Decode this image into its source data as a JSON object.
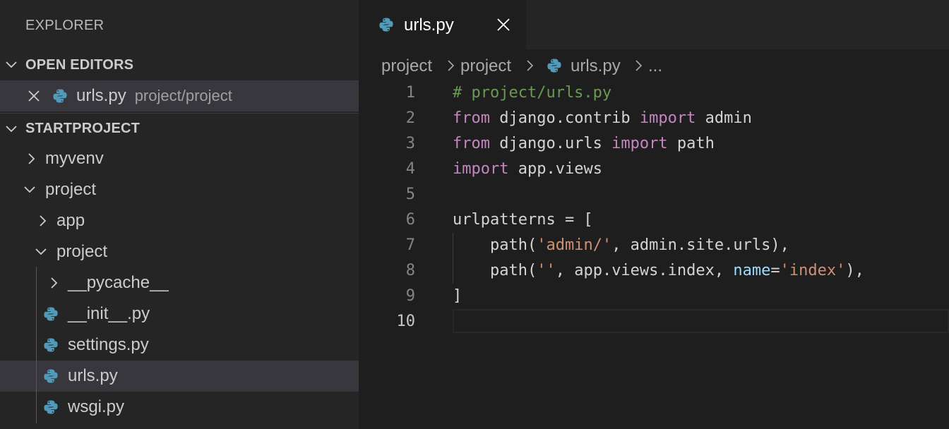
{
  "sidebar": {
    "title": "EXPLORER",
    "open_editors": {
      "header": "OPEN EDITORS",
      "item": {
        "name": "urls.py",
        "path": "project/project"
      }
    },
    "folder": {
      "header": "STARTPROJECT",
      "items": [
        {
          "label": "myvenv"
        },
        {
          "label": "project"
        },
        {
          "label": "app"
        },
        {
          "label": "project"
        },
        {
          "label": "__pycache__"
        },
        {
          "label": "__init__.py"
        },
        {
          "label": "settings.py"
        },
        {
          "label": "urls.py"
        },
        {
          "label": "wsgi.py"
        }
      ]
    }
  },
  "editor": {
    "tab": {
      "label": "urls.py"
    },
    "breadcrumb": {
      "p1": "project",
      "p2": "project",
      "file": "urls.py",
      "more": "..."
    },
    "line_numbers": [
      "1",
      "2",
      "3",
      "4",
      "5",
      "6",
      "7",
      "8",
      "9",
      "10"
    ],
    "code": {
      "l1": "# project/urls.py",
      "l2": {
        "kw1": "from",
        "mod": " django.contrib ",
        "kw2": "import",
        "name": " admin"
      },
      "l3": {
        "kw1": "from",
        "mod": " django.urls ",
        "kw2": "import",
        "name": " path"
      },
      "l4": {
        "kw1": "import",
        "name": " app.views"
      },
      "l6": "urlpatterns = [",
      "l7": {
        "a": "    path(",
        "s": "'admin/'",
        "b": ", admin.site.urls),"
      },
      "l8": {
        "a": "    path(",
        "s1": "''",
        "b": ", app.views.index, ",
        "p": "name",
        "eq": "=",
        "s2": "'index'",
        "c": "),"
      },
      "l9": "]"
    }
  },
  "colors": {
    "keyword": "#c586c0",
    "comment": "#6a9955",
    "string": "#ce9178",
    "param": "#9cdcfe",
    "python_blue": "#519aba"
  },
  "icons": [
    "chevron-down-icon",
    "chevron-right-icon",
    "close-icon",
    "python-file-icon"
  ]
}
